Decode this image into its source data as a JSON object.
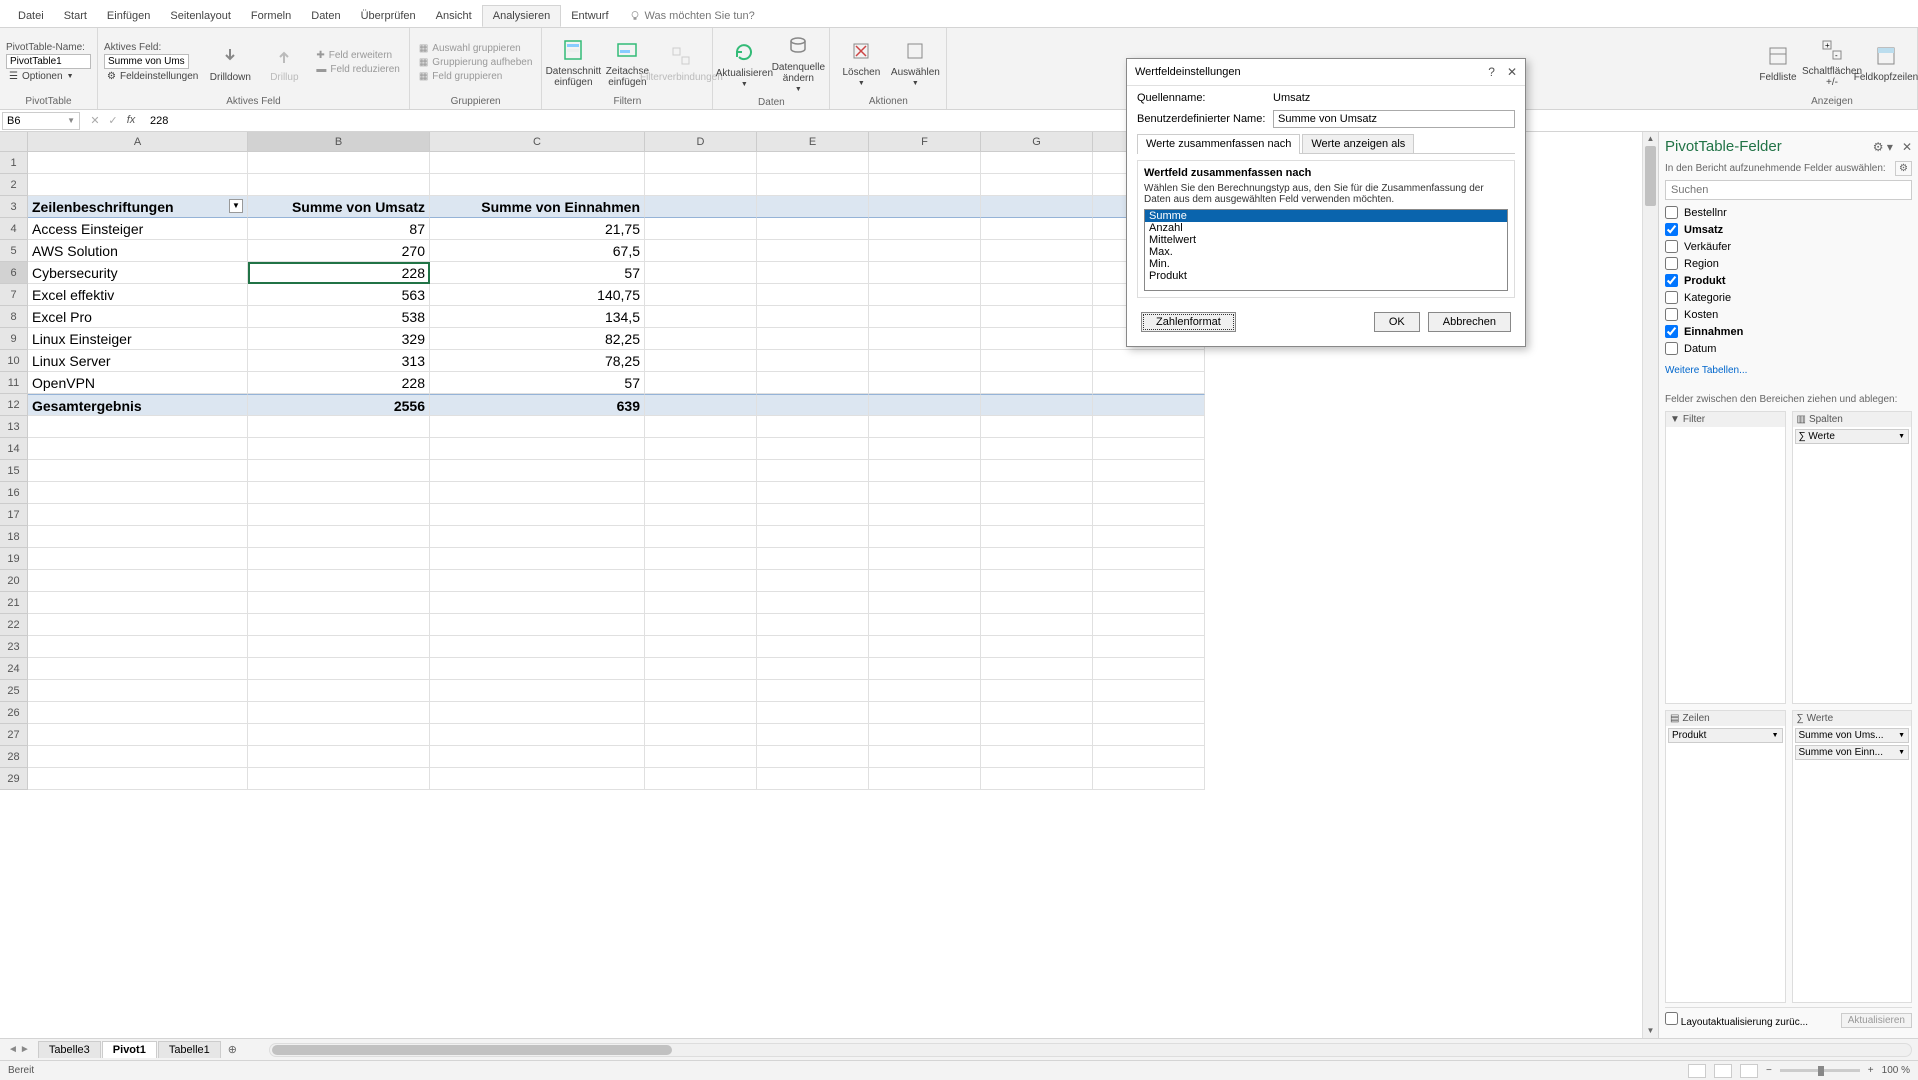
{
  "ribbonTabs": [
    "Datei",
    "Start",
    "Einfügen",
    "Seitenlayout",
    "Formeln",
    "Daten",
    "Überprüfen",
    "Ansicht",
    "Analysieren",
    "Entwurf"
  ],
  "activeTab": "Analysieren",
  "tellMe": "Was möchten Sie tun?",
  "ribbon": {
    "pivot": {
      "nameLabel": "PivotTable-Name:",
      "nameValue": "PivotTable1",
      "optionsBtn": "Optionen",
      "groupLabel": "PivotTable"
    },
    "activeField": {
      "label": "Aktives Feld:",
      "value": "Summe von Ums",
      "fieldSettings": "Feldeinstellungen",
      "drilldown": "Drilldown",
      "drillup": "Drillup",
      "expand": "Feld erweitern",
      "collapse": "Feld reduzieren",
      "groupLabel": "Aktives Feld"
    },
    "group": {
      "groupSel": "Auswahl gruppieren",
      "ungroup": "Gruppierung aufheben",
      "groupField": "Feld gruppieren",
      "groupLabel": "Gruppieren"
    },
    "filter": {
      "slicer": "Datenschnitt einfügen",
      "timeline": "Zeitachse einfügen",
      "connections": "Filterverbindungen",
      "groupLabel": "Filtern"
    },
    "data": {
      "refresh": "Aktualisieren",
      "changeSource": "Datenquelle ändern",
      "groupLabel": "Daten"
    },
    "actions": {
      "clear": "Löschen",
      "select": "Auswählen",
      "groupLabel": "Aktionen"
    },
    "show": {
      "fieldList": "Feldliste",
      "buttons": "Schaltflächen +/-",
      "headers": "Feldkopfzeilen",
      "groupLabel": "Anzeigen"
    }
  },
  "nameBox": "B6",
  "formulaValue": "228",
  "columns": [
    "A",
    "B",
    "C",
    "D",
    "E",
    "F",
    "G",
    "H"
  ],
  "colWidths": [
    "col-A",
    "col-B",
    "col-C",
    "col-D",
    "col-std",
    "col-std",
    "col-std",
    "col-std"
  ],
  "pivotHeaders": {
    "rowLabel": "Zeilenbeschriftungen",
    "col1": "Summe von Umsatz",
    "col2": "Summe von Einnahmen"
  },
  "pivotRows": [
    {
      "label": "Access Einsteiger",
      "v1": "87",
      "v2": "21,75"
    },
    {
      "label": "AWS Solution",
      "v1": "270",
      "v2": "67,5"
    },
    {
      "label": "Cybersecurity",
      "v1": "228",
      "v2": "57"
    },
    {
      "label": "Excel effektiv",
      "v1": "563",
      "v2": "140,75"
    },
    {
      "label": "Excel Pro",
      "v1": "538",
      "v2": "134,5"
    },
    {
      "label": "Linux Einsteiger",
      "v1": "329",
      "v2": "82,25"
    },
    {
      "label": "Linux Server",
      "v1": "313",
      "v2": "78,25"
    },
    {
      "label": "OpenVPN",
      "v1": "228",
      "v2": "57"
    }
  ],
  "pivotTotal": {
    "label": "Gesamtergebnis",
    "v1": "2556",
    "v2": "639"
  },
  "activeCellRow": 6,
  "dialog": {
    "title": "Wertfeldeinstellungen",
    "help": "?",
    "close": "✕",
    "sourceNameLabel": "Quellenname:",
    "sourceName": "Umsatz",
    "customNameLabel": "Benutzerdefinierter Name:",
    "customName": "Summe von Umsatz",
    "tab1": "Werte zusammenfassen nach",
    "tab2": "Werte anzeigen als",
    "groupTitle": "Wertfeld zusammenfassen nach",
    "desc": "Wählen Sie den Berechnungstyp aus, den Sie für die Zusammenfassung der Daten aus dem ausgewählten Feld verwenden möchten.",
    "options": [
      "Summe",
      "Anzahl",
      "Mittelwert",
      "Max.",
      "Min.",
      "Produkt"
    ],
    "selectedOption": 0,
    "numberFormat": "Zahlenformat",
    "ok": "OK",
    "cancel": "Abbrechen"
  },
  "fieldPane": {
    "title": "PivotTable-Felder",
    "subtitle": "In den Bericht aufzunehmende Felder auswählen:",
    "searchPlaceholder": "Suchen",
    "fields": [
      {
        "name": "Bestellnr",
        "checked": false
      },
      {
        "name": "Umsatz",
        "checked": true
      },
      {
        "name": "Verkäufer",
        "checked": false
      },
      {
        "name": "Region",
        "checked": false
      },
      {
        "name": "Produkt",
        "checked": true
      },
      {
        "name": "Kategorie",
        "checked": false
      },
      {
        "name": "Kosten",
        "checked": false
      },
      {
        "name": "Einnahmen",
        "checked": true
      },
      {
        "name": "Datum",
        "checked": false
      }
    ],
    "moreTables": "Weitere Tabellen...",
    "areasLabel": "Felder zwischen den Bereichen ziehen und ablegen:",
    "filterTitle": "Filter",
    "columnsTitle": "Spalten",
    "rowsTitle": "Zeilen",
    "valuesTitle": "Werte",
    "columnsItems": [
      "∑ Werte"
    ],
    "rowsItems": [
      "Produkt"
    ],
    "valuesItems": [
      "Summe von Ums...",
      "Summe von Einn..."
    ],
    "deferLabel": "Layoutaktualisierung zurüc...",
    "updateBtn": "Aktualisieren"
  },
  "sheets": [
    "Tabelle3",
    "Pivot1",
    "Tabelle1"
  ],
  "activeSheet": 1,
  "statusReady": "Bereit",
  "zoom": "100 %"
}
